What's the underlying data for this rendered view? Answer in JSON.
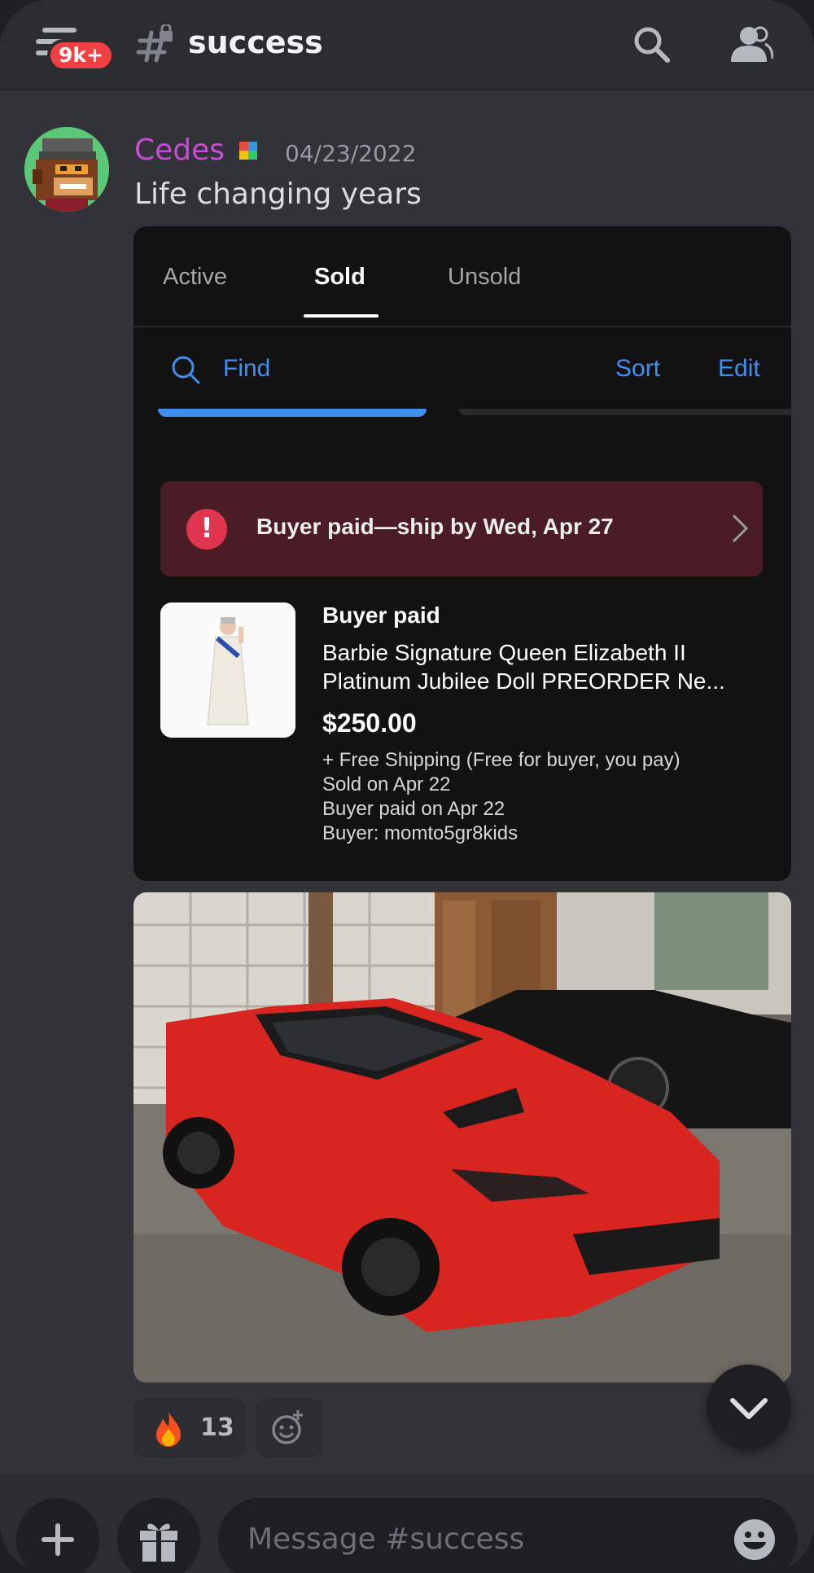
{
  "header": {
    "notification_badge": "9k+",
    "channel_name": "success"
  },
  "message": {
    "username": "Cedes",
    "timestamp": "04/23/2022",
    "text": "Life changing years"
  },
  "embed": {
    "tabs": [
      {
        "label": "Active",
        "active": false
      },
      {
        "label": "Sold",
        "active": true
      },
      {
        "label": "Unsold",
        "active": false
      }
    ],
    "find_label": "Find",
    "sort_label": "Sort",
    "edit_label": "Edit",
    "alert_text": "Buyer paid—ship by Wed, Apr 27",
    "item": {
      "status": "Buyer paid",
      "title_line1": "Barbie Signature Queen Elizabeth II",
      "title_line2": "Platinum Jubilee Doll PREORDER Ne...",
      "price": "$250.00",
      "shipping": "+ Free Shipping (Free for buyer, you pay)",
      "sold_on": "Sold on Apr 22",
      "paid_on": "Buyer paid on Apr 22",
      "buyer": "Buyer: momto5gr8kids"
    }
  },
  "reactions": [
    {
      "emoji": "fire-icon",
      "count": "13"
    }
  ],
  "composer": {
    "placeholder": "Message #success"
  },
  "colors": {
    "background": "#313338",
    "username": "#c94bd6",
    "link_blue": "#3f8ff0",
    "alert_bg": "#4a1c26",
    "badge_red": "#f23f43"
  }
}
